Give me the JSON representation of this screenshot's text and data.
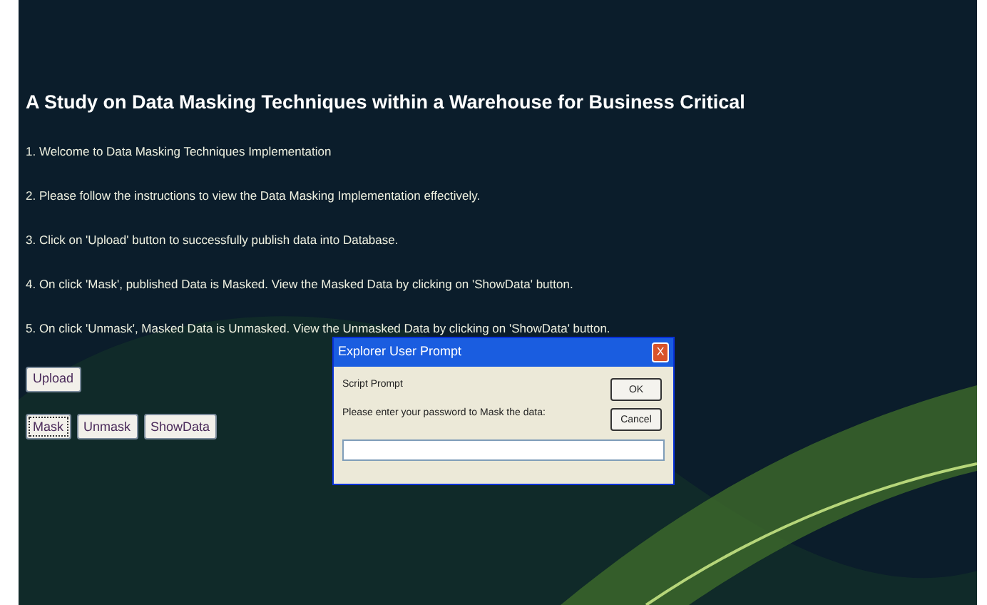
{
  "title": "A Study on Data Masking Techniques within a Warehouse for Business Critical",
  "instructions": [
    "1. Welcome to Data Masking Techniques Implementation",
    "2. Please follow the instructions to view the Data Masking Implementation effectively.",
    "3. Click on 'Upload' button to successfully publish data into Database.",
    "4. On click 'Mask', published Data is Masked. View the Masked Data by clicking on 'ShowData' button.",
    "5. On click 'Unmask', Masked Data is Unmasked. View the Unmasked Data by clicking on 'ShowData' button."
  ],
  "upload_button": {
    "label": "Upload",
    "focused": false
  },
  "buttons": [
    {
      "label": "Mask",
      "focused": true
    },
    {
      "label": "Unmask",
      "focused": false
    },
    {
      "label": "ShowData",
      "focused": false
    }
  ],
  "dialog": {
    "title": "Explorer User Prompt",
    "close": "X",
    "heading": "Script Prompt",
    "message": "Please enter your password to Mask the data:",
    "buttons": [
      "OK",
      "Cancel"
    ]
  }
}
